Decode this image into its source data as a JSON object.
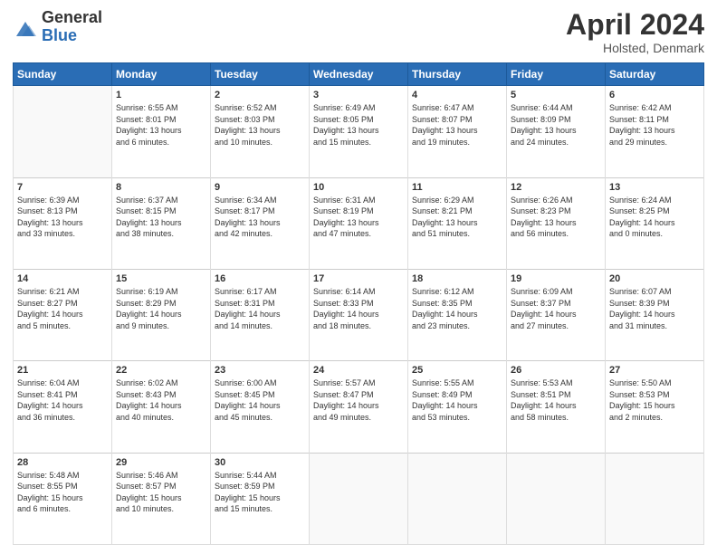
{
  "header": {
    "logo_general": "General",
    "logo_blue": "Blue",
    "month": "April 2024",
    "location": "Holsted, Denmark"
  },
  "days_of_week": [
    "Sunday",
    "Monday",
    "Tuesday",
    "Wednesday",
    "Thursday",
    "Friday",
    "Saturday"
  ],
  "weeks": [
    [
      {
        "day": "",
        "info": ""
      },
      {
        "day": "1",
        "info": "Sunrise: 6:55 AM\nSunset: 8:01 PM\nDaylight: 13 hours\nand 6 minutes."
      },
      {
        "day": "2",
        "info": "Sunrise: 6:52 AM\nSunset: 8:03 PM\nDaylight: 13 hours\nand 10 minutes."
      },
      {
        "day": "3",
        "info": "Sunrise: 6:49 AM\nSunset: 8:05 PM\nDaylight: 13 hours\nand 15 minutes."
      },
      {
        "day": "4",
        "info": "Sunrise: 6:47 AM\nSunset: 8:07 PM\nDaylight: 13 hours\nand 19 minutes."
      },
      {
        "day": "5",
        "info": "Sunrise: 6:44 AM\nSunset: 8:09 PM\nDaylight: 13 hours\nand 24 minutes."
      },
      {
        "day": "6",
        "info": "Sunrise: 6:42 AM\nSunset: 8:11 PM\nDaylight: 13 hours\nand 29 minutes."
      }
    ],
    [
      {
        "day": "7",
        "info": "Sunrise: 6:39 AM\nSunset: 8:13 PM\nDaylight: 13 hours\nand 33 minutes."
      },
      {
        "day": "8",
        "info": "Sunrise: 6:37 AM\nSunset: 8:15 PM\nDaylight: 13 hours\nand 38 minutes."
      },
      {
        "day": "9",
        "info": "Sunrise: 6:34 AM\nSunset: 8:17 PM\nDaylight: 13 hours\nand 42 minutes."
      },
      {
        "day": "10",
        "info": "Sunrise: 6:31 AM\nSunset: 8:19 PM\nDaylight: 13 hours\nand 47 minutes."
      },
      {
        "day": "11",
        "info": "Sunrise: 6:29 AM\nSunset: 8:21 PM\nDaylight: 13 hours\nand 51 minutes."
      },
      {
        "day": "12",
        "info": "Sunrise: 6:26 AM\nSunset: 8:23 PM\nDaylight: 13 hours\nand 56 minutes."
      },
      {
        "day": "13",
        "info": "Sunrise: 6:24 AM\nSunset: 8:25 PM\nDaylight: 14 hours\nand 0 minutes."
      }
    ],
    [
      {
        "day": "14",
        "info": "Sunrise: 6:21 AM\nSunset: 8:27 PM\nDaylight: 14 hours\nand 5 minutes."
      },
      {
        "day": "15",
        "info": "Sunrise: 6:19 AM\nSunset: 8:29 PM\nDaylight: 14 hours\nand 9 minutes."
      },
      {
        "day": "16",
        "info": "Sunrise: 6:17 AM\nSunset: 8:31 PM\nDaylight: 14 hours\nand 14 minutes."
      },
      {
        "day": "17",
        "info": "Sunrise: 6:14 AM\nSunset: 8:33 PM\nDaylight: 14 hours\nand 18 minutes."
      },
      {
        "day": "18",
        "info": "Sunrise: 6:12 AM\nSunset: 8:35 PM\nDaylight: 14 hours\nand 23 minutes."
      },
      {
        "day": "19",
        "info": "Sunrise: 6:09 AM\nSunset: 8:37 PM\nDaylight: 14 hours\nand 27 minutes."
      },
      {
        "day": "20",
        "info": "Sunrise: 6:07 AM\nSunset: 8:39 PM\nDaylight: 14 hours\nand 31 minutes."
      }
    ],
    [
      {
        "day": "21",
        "info": "Sunrise: 6:04 AM\nSunset: 8:41 PM\nDaylight: 14 hours\nand 36 minutes."
      },
      {
        "day": "22",
        "info": "Sunrise: 6:02 AM\nSunset: 8:43 PM\nDaylight: 14 hours\nand 40 minutes."
      },
      {
        "day": "23",
        "info": "Sunrise: 6:00 AM\nSunset: 8:45 PM\nDaylight: 14 hours\nand 45 minutes."
      },
      {
        "day": "24",
        "info": "Sunrise: 5:57 AM\nSunset: 8:47 PM\nDaylight: 14 hours\nand 49 minutes."
      },
      {
        "day": "25",
        "info": "Sunrise: 5:55 AM\nSunset: 8:49 PM\nDaylight: 14 hours\nand 53 minutes."
      },
      {
        "day": "26",
        "info": "Sunrise: 5:53 AM\nSunset: 8:51 PM\nDaylight: 14 hours\nand 58 minutes."
      },
      {
        "day": "27",
        "info": "Sunrise: 5:50 AM\nSunset: 8:53 PM\nDaylight: 15 hours\nand 2 minutes."
      }
    ],
    [
      {
        "day": "28",
        "info": "Sunrise: 5:48 AM\nSunset: 8:55 PM\nDaylight: 15 hours\nand 6 minutes."
      },
      {
        "day": "29",
        "info": "Sunrise: 5:46 AM\nSunset: 8:57 PM\nDaylight: 15 hours\nand 10 minutes."
      },
      {
        "day": "30",
        "info": "Sunrise: 5:44 AM\nSunset: 8:59 PM\nDaylight: 15 hours\nand 15 minutes."
      },
      {
        "day": "",
        "info": ""
      },
      {
        "day": "",
        "info": ""
      },
      {
        "day": "",
        "info": ""
      },
      {
        "day": "",
        "info": ""
      }
    ]
  ]
}
